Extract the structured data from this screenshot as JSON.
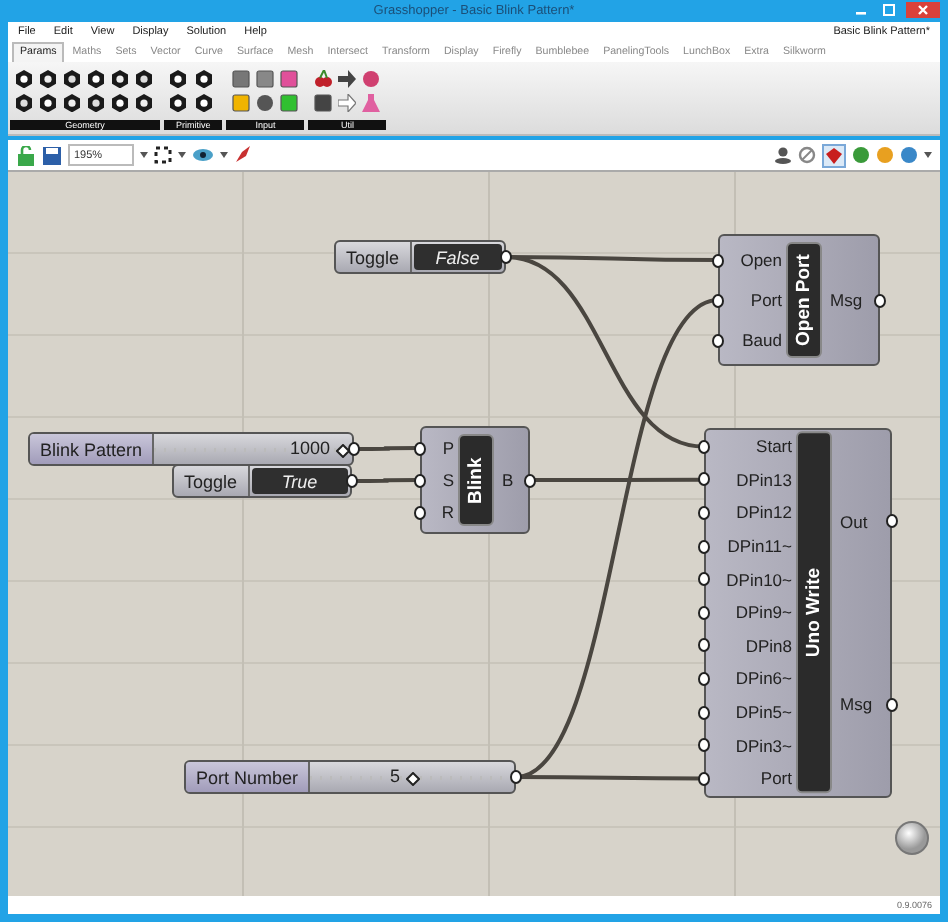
{
  "window": {
    "title": "Grasshopper - Basic Blink Pattern*"
  },
  "menu": [
    "File",
    "Edit",
    "View",
    "Display",
    "Solution",
    "Help"
  ],
  "document_title": "Basic Blink Pattern*",
  "tabs": [
    {
      "label": "Params",
      "selected": true
    },
    {
      "label": "Maths",
      "selected": false
    },
    {
      "label": "Sets",
      "selected": false
    },
    {
      "label": "Vector",
      "selected": false
    },
    {
      "label": "Curve",
      "selected": false
    },
    {
      "label": "Surface",
      "selected": false
    },
    {
      "label": "Mesh",
      "selected": false
    },
    {
      "label": "Intersect",
      "selected": false
    },
    {
      "label": "Transform",
      "selected": false
    },
    {
      "label": "Display",
      "selected": false
    },
    {
      "label": "Firefly",
      "selected": false
    },
    {
      "label": "Bumblebee",
      "selected": false
    },
    {
      "label": "PanelingTools",
      "selected": false
    },
    {
      "label": "LunchBox",
      "selected": false
    },
    {
      "label": "Extra",
      "selected": false
    },
    {
      "label": "Silkworm",
      "selected": false
    }
  ],
  "ribbon_groups": [
    {
      "label": "Geometry"
    },
    {
      "label": "Primitive"
    },
    {
      "label": "Input"
    },
    {
      "label": "Util"
    }
  ],
  "zoom": "195%",
  "nodes": [
    {
      "kind": "toggle",
      "label": "Toggle",
      "value": "False"
    },
    {
      "kind": "component",
      "name": "Open Port",
      "inputs": [
        "Open",
        "Port",
        "Baud"
      ],
      "outputs": [
        "Msg"
      ]
    },
    {
      "kind": "slider",
      "label": "Blink Pattern",
      "value": "1000",
      "level": 0.95
    },
    {
      "kind": "toggle",
      "label": "Toggle",
      "value": "True"
    },
    {
      "kind": "component",
      "name": "Blink",
      "inputs": [
        "P",
        "S",
        "R"
      ],
      "outputs": [
        "B"
      ]
    },
    {
      "kind": "component",
      "name": "Uno Write",
      "inputs": [
        "Start",
        "DPin13",
        "DPin12",
        "DPin11~",
        "DPin10~",
        "DPin9~",
        "DPin8",
        "DPin6~",
        "DPin5~",
        "DPin3~",
        "Port"
      ],
      "outputs": [
        "Out",
        "Msg"
      ]
    },
    {
      "kind": "slider",
      "label": "Port Number",
      "value": "5",
      "level": 0.5
    }
  ],
  "status": "0.9.0076"
}
